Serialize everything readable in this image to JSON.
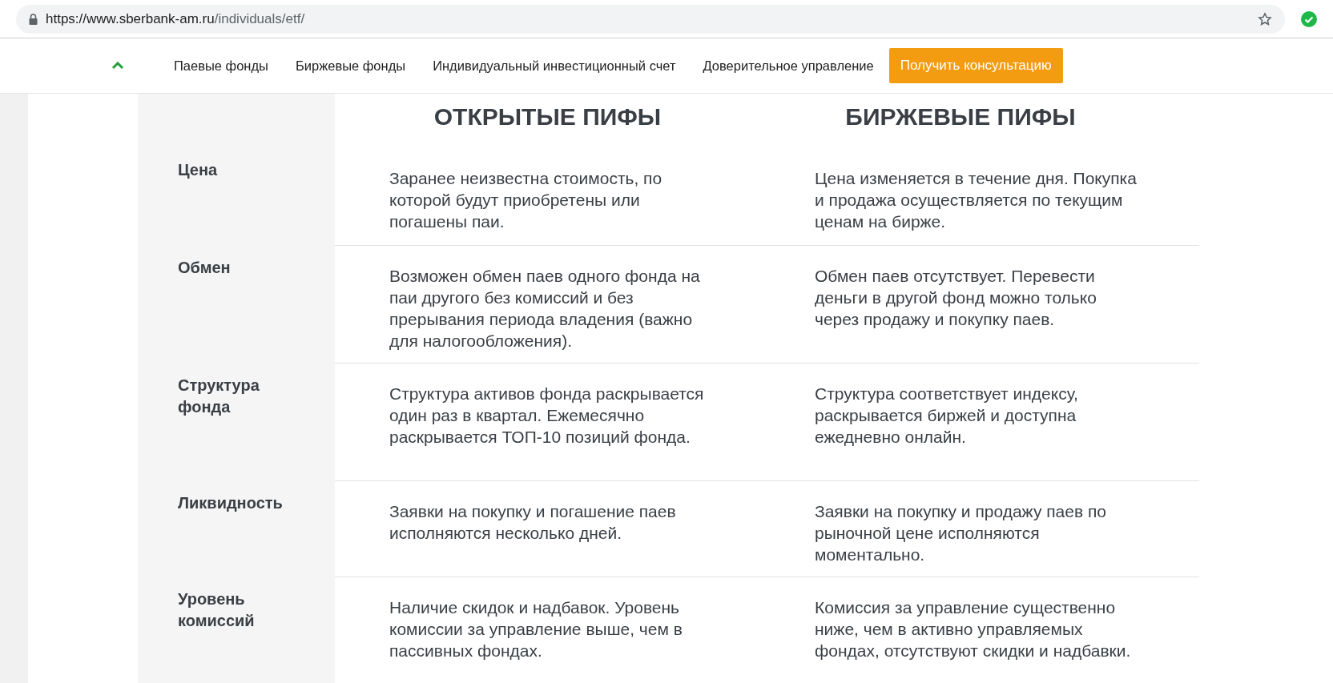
{
  "browser": {
    "url_host": "https://www.sberbank-am.ru",
    "url_path": "/individuals/etf/"
  },
  "nav": {
    "items": [
      {
        "label": "Паевые фонды"
      },
      {
        "label": "Биржевые фонды"
      },
      {
        "label": "Индивидуальный инвестиционный счет"
      },
      {
        "label": "Доверительное управление"
      }
    ],
    "cta": "Получить консультацию"
  },
  "table": {
    "columns": [
      "ОТКРЫТЫЕ ПИФЫ",
      "БИРЖЕВЫЕ ПИФЫ"
    ],
    "rows": [
      {
        "label": "Цена",
        "open": "Заранее неизвестна стоимость, по которой будут приобретены или погашены паи.",
        "exchange": "Цена изменяется в течение дня. Покупка и продажа осуществляется по текущим ценам на бирже."
      },
      {
        "label": "Обмен",
        "open": "Возможен обмен паев одного фонда на паи другого без комиссий и без прерывания периода владения (важно для налогообложения).",
        "exchange": "Обмен паев отсутствует. Перевести деньги в другой фонд можно только через продажу и покупку паев."
      },
      {
        "label": "Структура фонда",
        "open": "Структура активов фонда раскрывается один раз в квартал. Ежемесячно раскрывается ТОП-10 позиций фонда.",
        "exchange": "Структура соответствует индексу, раскрывается биржей и доступна ежедневно онлайн."
      },
      {
        "label": "Ликвидность",
        "open": "Заявки на покупку и погашение паев исполняются несколько дней.",
        "exchange": "Заявки на покупку и продажу паев по рыночной цене исполняются моментально."
      },
      {
        "label": "Уровень комиссий",
        "open": "Наличие скидок и надбавок. Уровень комиссии за управление выше, чем в пассивных фондах.",
        "exchange": "Комиссия за управление существенно ниже, чем в активно управляемых фондах, отсутствуют скидки и надбавки."
      }
    ]
  }
}
